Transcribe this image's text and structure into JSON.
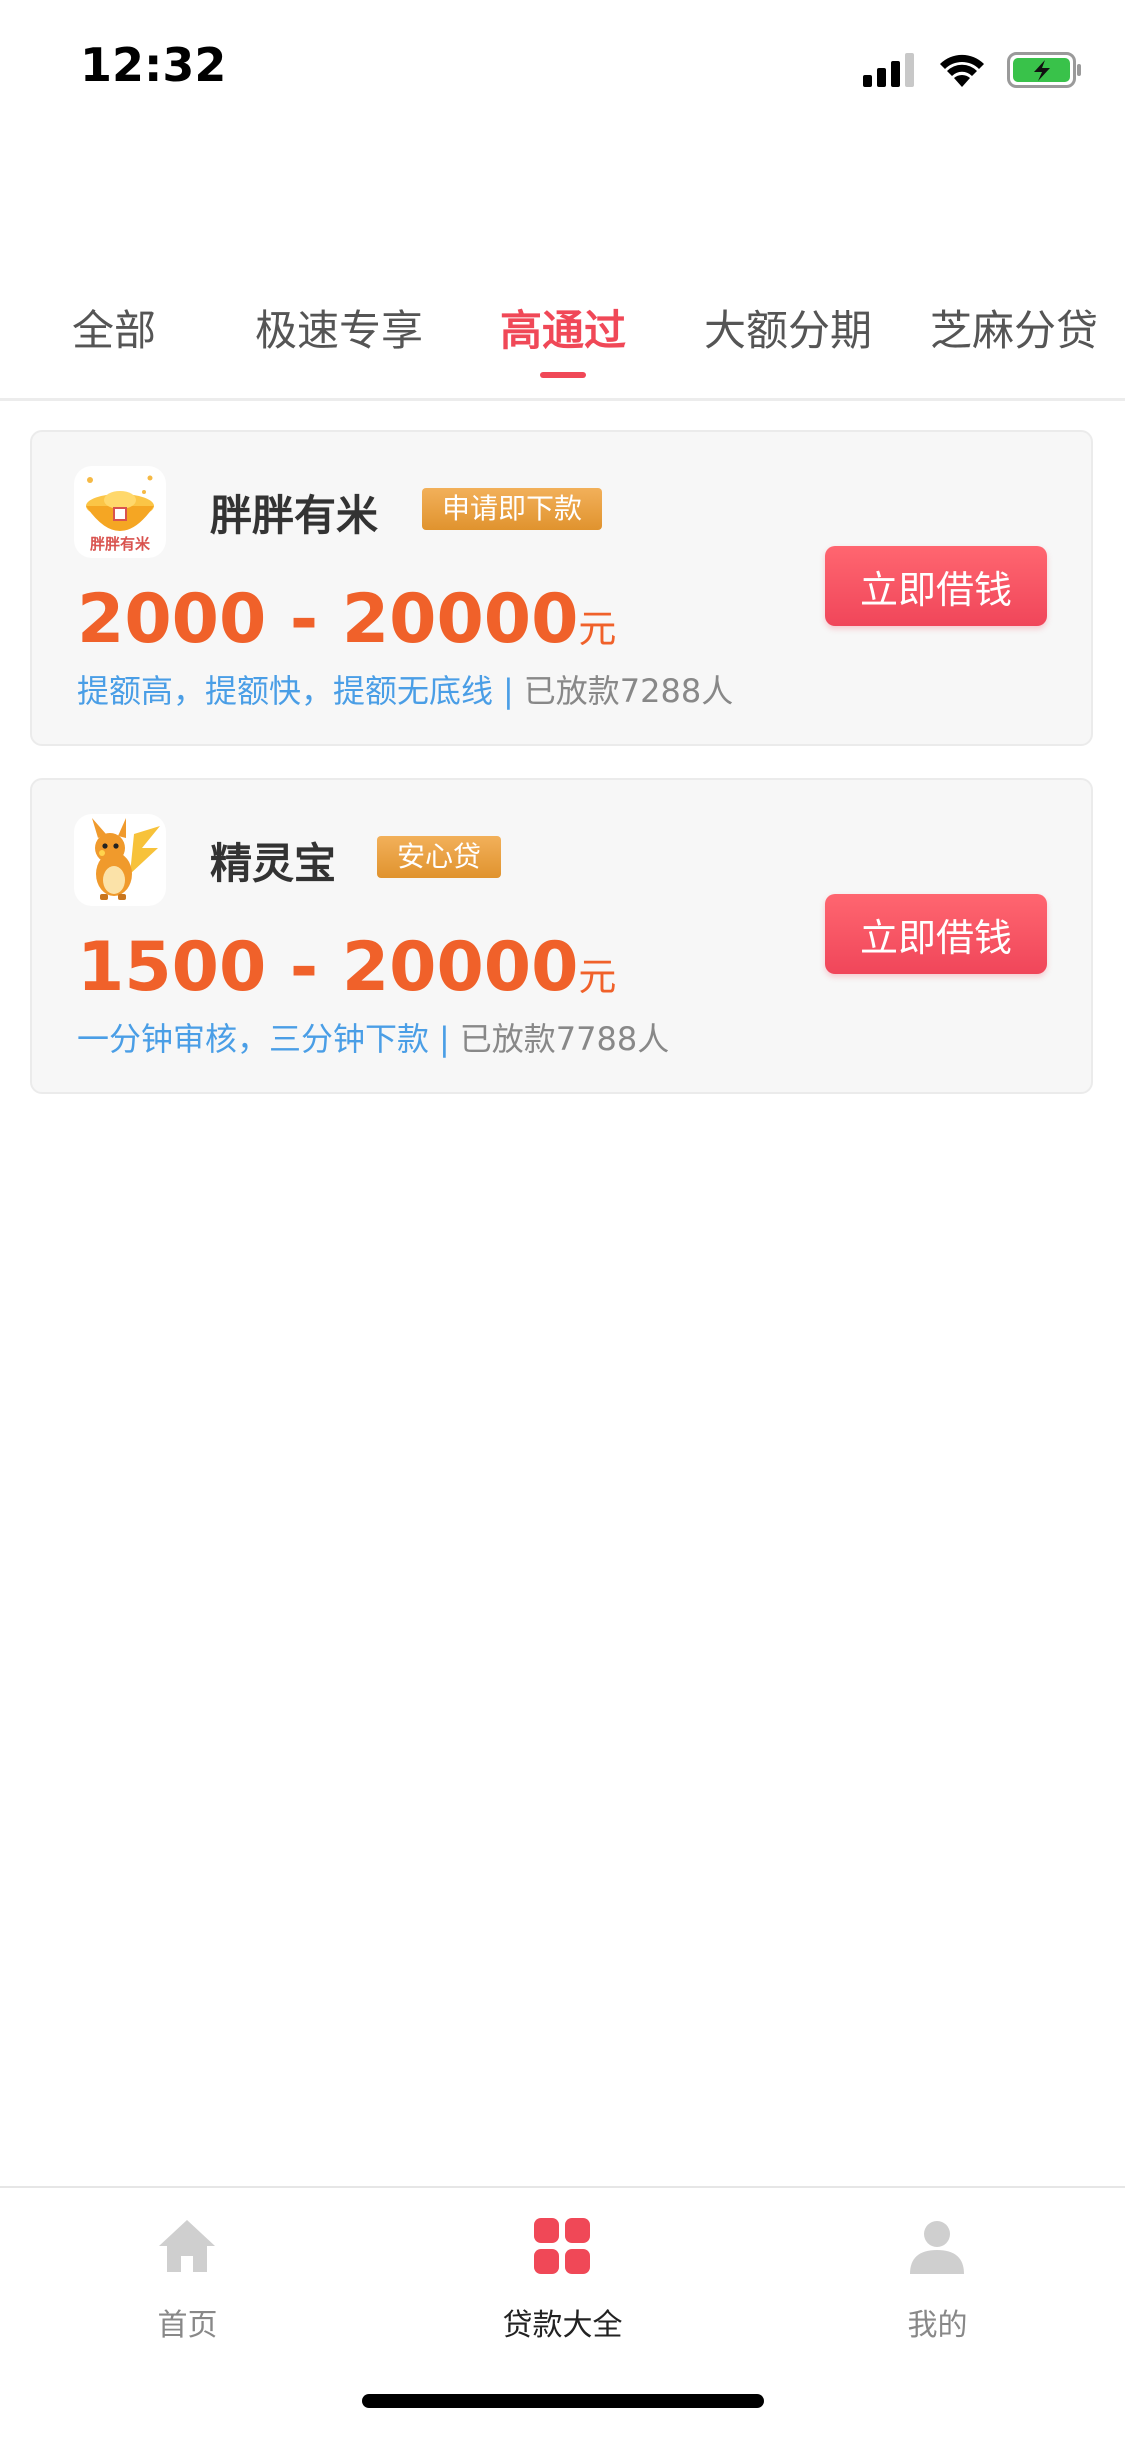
{
  "status_bar": {
    "time": "12:32"
  },
  "tabs": [
    {
      "label": "全部",
      "active": false
    },
    {
      "label": "极速专享",
      "active": false
    },
    {
      "label": "高通过",
      "active": true
    },
    {
      "label": "大额分期",
      "active": false
    },
    {
      "label": "芝麻分贷",
      "active": false
    }
  ],
  "products": [
    {
      "name": "胖胖有米",
      "logo_text": "胖胖有米",
      "badge": "申请即下款",
      "amount": "2000 - 20000",
      "unit": "元",
      "feature": "提额高，提额快，提额无底线",
      "separator": "|",
      "loaned": "已放款7288人",
      "button": "立即借钱"
    },
    {
      "name": "精灵宝",
      "badge": "安心贷",
      "amount": "1500 - 20000",
      "unit": "元",
      "feature": "一分钟审核，三分钟下款",
      "separator": "|",
      "loaned": "已放款7788人",
      "button": "立即借钱"
    }
  ],
  "bottom_nav": [
    {
      "label": "首页",
      "icon": "home-icon",
      "active": false
    },
    {
      "label": "贷款大全",
      "icon": "grid-icon",
      "active": true
    },
    {
      "label": "我的",
      "icon": "user-icon",
      "active": false
    }
  ],
  "colors": {
    "accent": "#f04857",
    "amount": "#f0612a",
    "feature": "#4a9ee6",
    "badge": "#e8a040"
  }
}
